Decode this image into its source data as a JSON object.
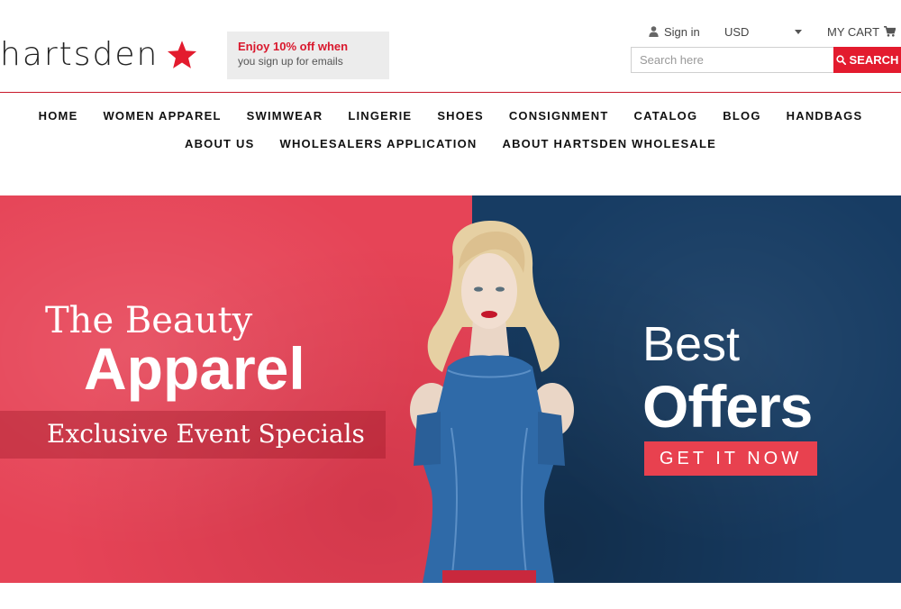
{
  "brand": {
    "logo_text": "hartsden",
    "star_color": "#e31b2e"
  },
  "promo": {
    "title": "Enjoy 10% off when",
    "subtitle": "you sign up for emails"
  },
  "topbar": {
    "signin_label": "Sign in",
    "currency_value": "USD",
    "cart_label": "MY CART"
  },
  "search": {
    "placeholder": "Search here",
    "value": "",
    "button_label": "SEARCH"
  },
  "nav": {
    "row1": [
      "HOME",
      "WOMEN APPAREL",
      "SWIMWEAR",
      "LINGERIE",
      "SHOES",
      "CONSIGNMENT",
      "CATALOG",
      "BLOG",
      "HANDBAGS"
    ],
    "row2": [
      "ABOUT US",
      "WHOLESALERS APPLICATION",
      "ABOUT HARTSDEN WHOLESALE"
    ]
  },
  "hero": {
    "line1": "The Beauty",
    "line2": "Apparel",
    "line3": "Exclusive Event Specials",
    "best": "Best",
    "offers": "Offers",
    "cta": "GET IT NOW",
    "left_color": "#e64457",
    "right_color": "#173c63"
  },
  "colors": {
    "accent": "#e31b2e",
    "rule": "#c8192b"
  }
}
